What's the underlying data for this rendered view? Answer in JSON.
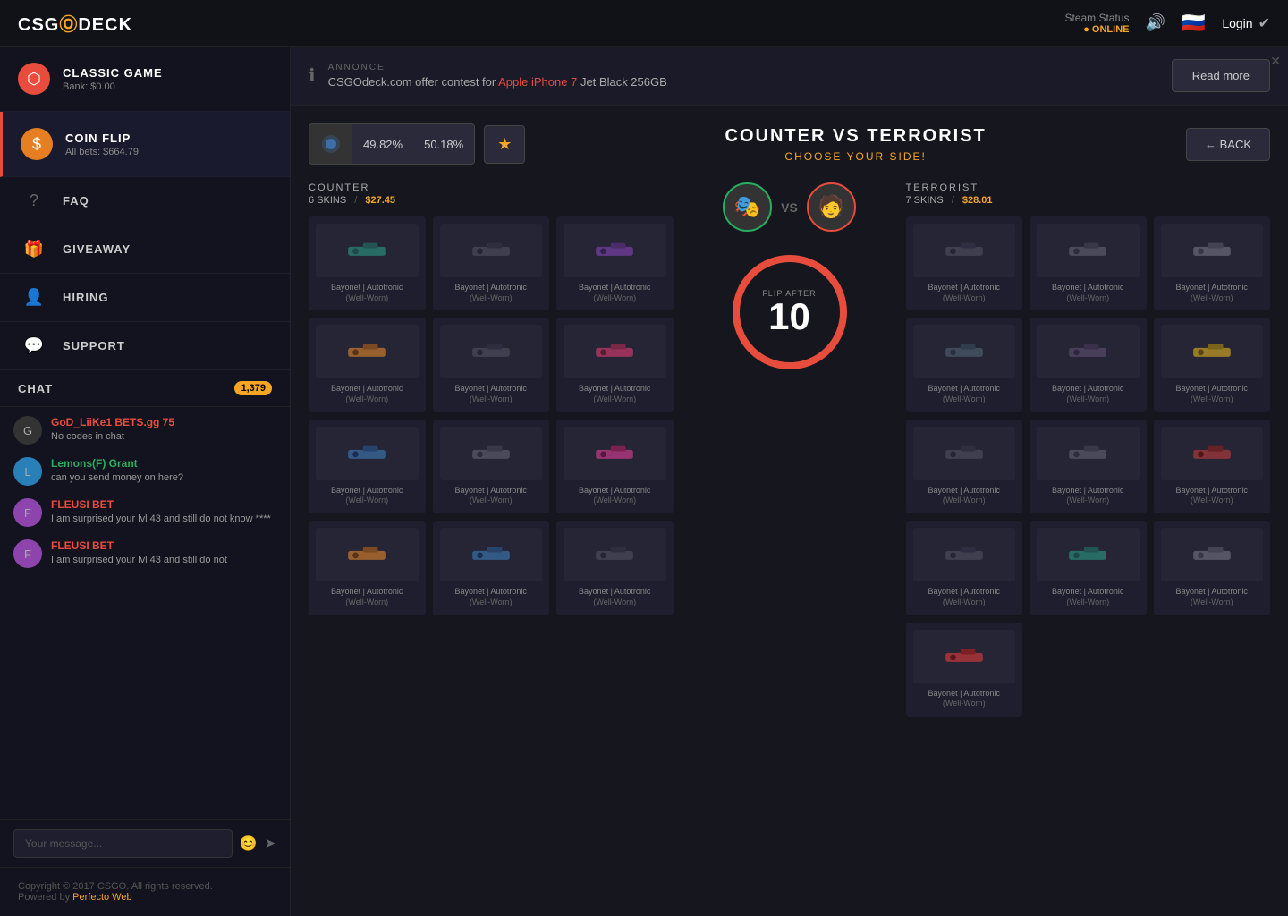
{
  "topnav": {
    "logo_text": "CSG",
    "logo_special": "O",
    "logo_suffix": "DECK",
    "steam_status_label": "Steam Status",
    "steam_online": "● ONLINE",
    "login_label": "Login"
  },
  "sidebar": {
    "classic_game": {
      "title": "CLASSIC GAME",
      "bank": "Bank: $0.00"
    },
    "coin_flip": {
      "title": "COIN FLIP",
      "bets": "All bets: $664.79"
    },
    "nav_items": [
      {
        "id": "faq",
        "label": "FAQ"
      },
      {
        "id": "giveaway",
        "label": "GIVEAWAY"
      },
      {
        "id": "hiring",
        "label": "HIRING"
      },
      {
        "id": "support",
        "label": "SUPPORT"
      }
    ],
    "chat": {
      "label": "CHAT",
      "count": "1,379",
      "input_placeholder": "Your message..."
    },
    "messages": [
      {
        "username": "GoD_LiiKe1 BETS.gg 75",
        "message": "No codes in chat",
        "color": "red"
      },
      {
        "username": "Lemons(F) Grant",
        "message": "can you send money on here?",
        "color": "green"
      },
      {
        "username": "FLEUSI BET",
        "message": "I am surprised your lvl 43 and still do not know ****",
        "color": "purple"
      },
      {
        "username": "FLEUSI BET",
        "message": "I am surprised your lvl 43 and still do not",
        "color": "purple"
      }
    ],
    "footer": {
      "copyright": "Copyright © 2017 CSGO. All rights reserved.",
      "powered_by": "Powered by",
      "link_text": "Perfecto Web"
    }
  },
  "announcement": {
    "section_label": "ANNONCE",
    "text_before": "CSGOdeck.com offer contest for",
    "highlight": "Apple iPhone 7",
    "text_after": "Jet Black 256GB",
    "read_more": "Read more"
  },
  "coinflip": {
    "percentages": {
      "left": "49.82%",
      "right": "50.18%"
    },
    "back_label": "← BACK",
    "title": "COUNTER VS TERRORIST",
    "subtitle": "CHOOSE YOUR SIDE!",
    "vs_text": "VS",
    "timer": {
      "flip_after_label": "FLIP AFTER",
      "countdown": "10"
    },
    "counter": {
      "title": "COUNTER",
      "skins_count": "6 SKINS",
      "value": "$27.45",
      "sep": "/"
    },
    "terrorist": {
      "title": "TERRORIST",
      "skins_count": "7 SKINS",
      "value": "$28.01",
      "sep": "/"
    },
    "skin_name": "Bayonet | Autotronic",
    "skin_condition": "(Well-Worn)",
    "skins_counter": [
      {
        "color": "teal"
      },
      {
        "color": "gray"
      },
      {
        "color": "purple"
      },
      {
        "color": "orange"
      },
      {
        "color": "gray"
      },
      {
        "color": "red"
      },
      {
        "color": "blue"
      },
      {
        "color": "gray"
      },
      {
        "color": "pink"
      },
      {
        "color": "orange"
      },
      {
        "color": "blue"
      },
      {
        "color": "gray"
      }
    ],
    "skins_terrorist": [
      {
        "color": "gray"
      },
      {
        "color": "gray"
      },
      {
        "color": "gray"
      },
      {
        "color": "gray"
      },
      {
        "color": "gray"
      },
      {
        "color": "gold"
      },
      {
        "color": "gray"
      },
      {
        "color": "gray"
      },
      {
        "color": "red"
      },
      {
        "color": "gray"
      },
      {
        "color": "gray"
      },
      {
        "color": "teal"
      },
      {
        "color": "red"
      }
    ]
  }
}
